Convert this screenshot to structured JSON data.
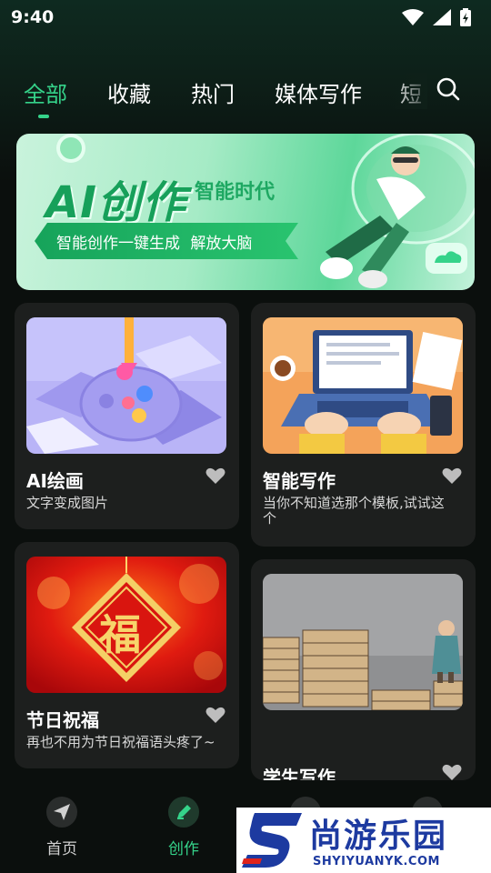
{
  "status_bar": {
    "time": "9:40"
  },
  "tabs": [
    {
      "label": "全部",
      "active": true
    },
    {
      "label": "收藏",
      "active": false
    },
    {
      "label": "热门",
      "active": false
    },
    {
      "label": "媒体写作",
      "active": false
    },
    {
      "label": "短",
      "active": false
    }
  ],
  "banner": {
    "title": "AI创作",
    "subtitle": "智能时代",
    "tagline": "智能创作一键生成  解放大脑"
  },
  "cards": [
    {
      "title": "AI绘画",
      "description": "文字变成图片"
    },
    {
      "title": "智能写作",
      "description": "当你不知道选那个模板,试试这个"
    },
    {
      "title": "节日祝福",
      "description": "再也不用为节日祝福语头疼了~"
    },
    {
      "title": "学生写作",
      "description": ""
    }
  ],
  "bottom_nav": [
    {
      "label": "首页",
      "icon": "paper-plane-icon",
      "active": false
    },
    {
      "label": "创作",
      "icon": "pen-icon",
      "active": true
    },
    {
      "label": "",
      "icon": "circle-icon",
      "active": false
    },
    {
      "label": "",
      "icon": "person-icon",
      "active": false
    }
  ],
  "watermark": {
    "text": "尚游乐园",
    "url": "SHYIYUANYK.COM"
  },
  "colors": {
    "accent": "#35d38a",
    "card_bg": "#1d1f1e",
    "page_bg": "#0b0f0d",
    "banner_green": "#17a05a",
    "watermark_blue": "#1d3aa0"
  }
}
